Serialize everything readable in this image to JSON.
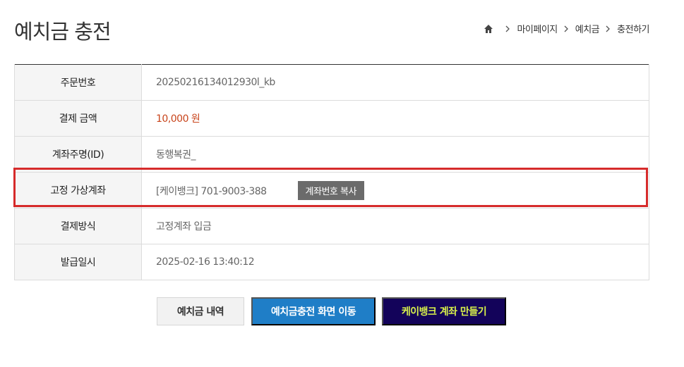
{
  "header": {
    "title": "예치금 충전",
    "breadcrumb": [
      "마이페이지",
      "예치금",
      "충전하기"
    ]
  },
  "info": {
    "rows": [
      {
        "label": "주문번호",
        "value": "20250216134012930l_kb"
      },
      {
        "label": "결제 금액",
        "value": "10,000 원"
      },
      {
        "label": "계좌주명(ID)",
        "value": "동행복권_"
      },
      {
        "label": "고정 가상계좌",
        "value": "[케이뱅크] 701-9003-388"
      },
      {
        "label": "결제방식",
        "value": "고정계좌 입금"
      },
      {
        "label": "발급일시",
        "value": "2025-02-16 13:40:12"
      }
    ],
    "copy_button": "계좌번호 복사"
  },
  "buttons": {
    "history": "예치금 내역",
    "charge": "예치금충전 화면 이동",
    "kbank": "케이뱅크 계좌 만들기"
  },
  "colors": {
    "amount": "#c8441b",
    "charge_button": "#1f7ec7",
    "kbank_button": "#13035a",
    "kbank_text": "#d9f24a",
    "highlight": "#d62b2b"
  }
}
